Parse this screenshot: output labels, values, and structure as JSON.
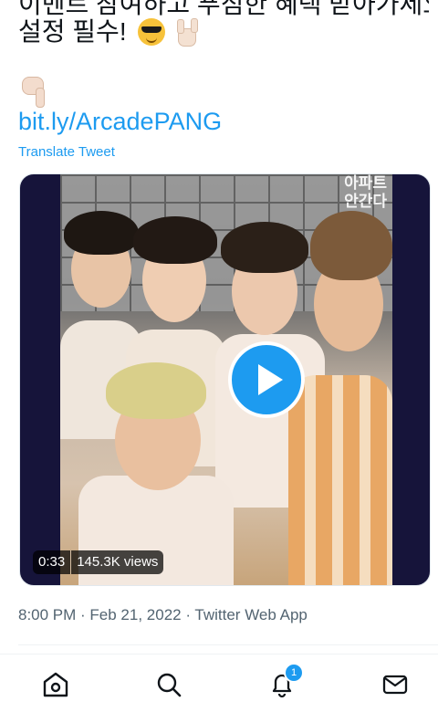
{
  "tweet": {
    "text_line1": "이벤트 참여하고 푸짐한 혜택 받아가세요! 알림",
    "text_line2": "설정 필수!",
    "link": "bit.ly/ArcadePANG",
    "translate_label": "Translate Tweet",
    "timestamp": "8:00 PM · Feb 21, 2022 · Twitter Web App"
  },
  "media": {
    "watermark": "아파트\n안간다",
    "duration": "0:33",
    "views": "145.3K views"
  },
  "nav": {
    "notification_count": "1"
  },
  "colors": {
    "link": "#1d9bf0",
    "play_button": "#1d9bf0",
    "media_background": "#16143a"
  }
}
